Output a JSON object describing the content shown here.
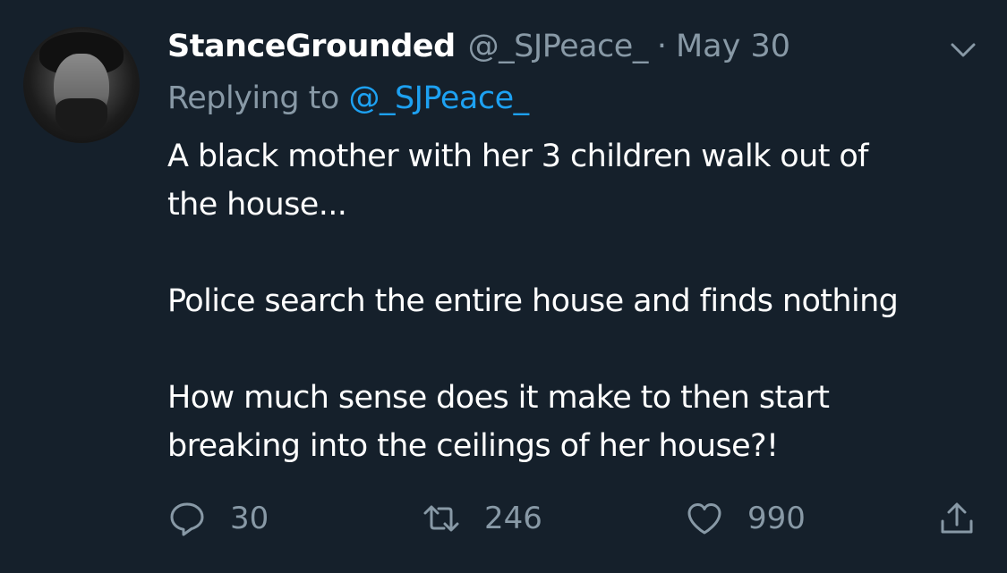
{
  "tweet": {
    "author_name": "StanceGrounded",
    "author_handle": "@_SJPeace_",
    "separator": "·",
    "date": "May 30",
    "replying_prefix": "Replying to ",
    "replying_handle": "@_SJPeace_",
    "text_lines": [
      "A black mother with her 3 children walk out of",
      "the house...",
      "Police search the entire house and finds nothing",
      "How much sense does it make to then start",
      "breaking into the ceilings of her house?!"
    ]
  },
  "actions": {
    "reply_count": "30",
    "retweet_count": "246",
    "like_count": "990"
  },
  "icons": {
    "menu": "chevron-down-icon",
    "reply": "reply-icon",
    "retweet": "retweet-icon",
    "like": "heart-icon",
    "share": "share-icon"
  },
  "colors": {
    "background": "#15202b",
    "text": "#ffffff",
    "muted": "#8899a6",
    "link": "#1da1f2"
  }
}
